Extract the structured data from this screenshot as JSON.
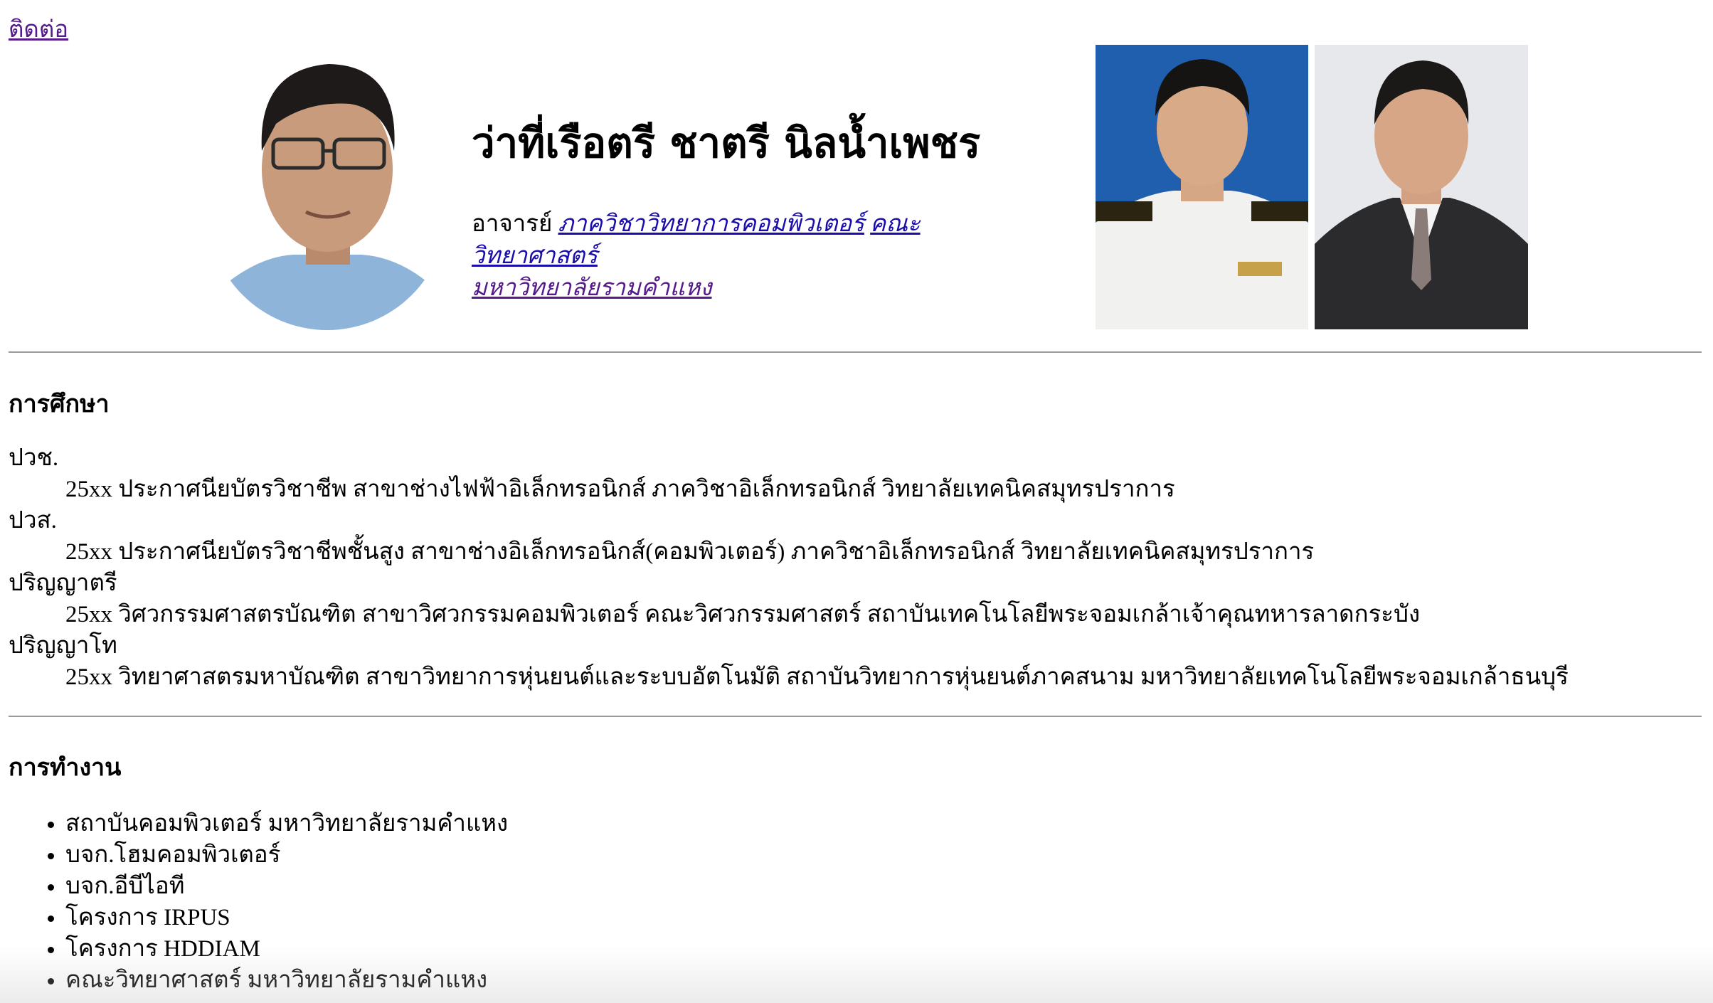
{
  "nav": {
    "contact_label": "ติดต่อ"
  },
  "header": {
    "name": "ว่าที่เรือตรี ชาตรี นิลน้ำเพชร",
    "position_prefix": "อาจารย์",
    "department_link": "ภาควิชาวิทยาการคอมพิวเตอร์",
    "faculty_link": "คณะวิทยาศาสตร์",
    "university_link": "มหาวิทยาลัยรามคำแหง"
  },
  "education": {
    "heading": "การศึกษา",
    "entries": [
      {
        "level": "ปวช.",
        "detail": "25xx ประกาศนียบัตรวิชาชีพ สาขาช่างไฟฟ้าอิเล็กทรอนิกส์ ภาควิชาอิเล็กทรอนิกส์ วิทยาลัยเทคนิคสมุทรปราการ"
      },
      {
        "level": "ปวส.",
        "detail": "25xx ประกาศนียบัตรวิชาชีพชั้นสูง สาขาช่างอิเล็กทรอนิกส์(คอมพิวเตอร์) ภาควิชาอิเล็กทรอนิกส์ วิทยาลัยเทคนิคสมุทรปราการ"
      },
      {
        "level": "ปริญญาตรี",
        "detail": "25xx วิศวกรรมศาสตรบัณฑิต สาขาวิศวกรรมคอมพิวเตอร์ คณะวิศวกรรมศาสตร์ สถาบันเทคโนโลยีพระจอมเกล้าเจ้าคุณทหารลาดกระบัง"
      },
      {
        "level": "ปริญญาโท",
        "detail": "25xx วิทยาศาสตรมหาบัณฑิต สาขาวิทยาการหุ่นยนต์และระบบอัตโนมัติ สถาบันวิทยาการหุ่นยนต์ภาคสนาม มหาวิทยาลัยเทคโนโลยีพระจอมเกล้าธนบุรี"
      }
    ]
  },
  "work": {
    "heading": "การทำงาน",
    "items": [
      "สถาบันคอมพิวเตอร์ มหาวิทยาลัยรามคำแหง",
      "บจก.โฮมคอมพิวเตอร์",
      "บจก.อีบีไอที",
      "โครงการ IRPUS",
      "โครงการ HDDIAM",
      "คณะวิทยาศาสตร์ มหาวิทยาลัยรามคำแหง"
    ]
  },
  "colors": {
    "link": "#1a0dab",
    "visited_link": "#551a8b",
    "separator": "#9a9a9a"
  }
}
